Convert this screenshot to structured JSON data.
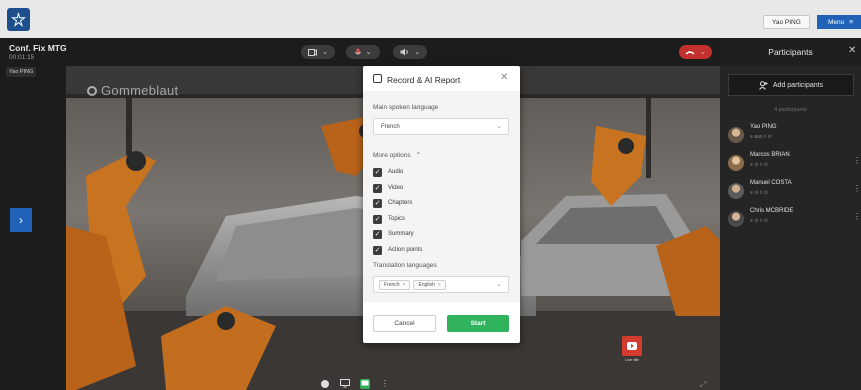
{
  "header": {
    "user_name": "Yao PING",
    "menu_label": "Menu",
    "colors": {
      "bar": "#e8e8e8",
      "accent": "#1f62b8",
      "logo_bg": "#1c4f8c"
    }
  },
  "conference": {
    "title": "Conf. Fix MTG",
    "elapsed": "00:01:15",
    "self_label": "Yao PING",
    "controls": {
      "camera_icon": "camera-icon",
      "mic_icon": "microphone-icon",
      "speaker_icon": "speaker-icon",
      "hangup_icon": "hang-up-icon",
      "end_color": "#c2312b"
    },
    "video": {
      "watermark": "Gommeblaut",
      "badge_label": "Live tile",
      "badge_color": "#d23b2e"
    },
    "bottom_tools": [
      "record-icon",
      "screen-share-icon",
      "chat-icon",
      "more-icon"
    ]
  },
  "participants_panel": {
    "title": "Participants",
    "add_label": "Add participants",
    "count_label": "4 participants",
    "participants": [
      {
        "name": "Yao PING",
        "status": "≡ aux ◊ ⊙"
      },
      {
        "name": "Marcos BRIAN",
        "status": "≡ ⊙ ◊ ⊙"
      },
      {
        "name": "Manuel COSTA",
        "status": "≡ ⊙ ◊ ⊙"
      },
      {
        "name": "Chris MCBRIDE",
        "status": "≡ ⊙ ◊ ⊙"
      }
    ]
  },
  "record_modal": {
    "title": "Record & AI Report",
    "language_label": "Main spoken language",
    "language_value": "French",
    "more_options_label": "More options",
    "options": [
      "Audio",
      "Video",
      "Chapters",
      "Topics",
      "Summary",
      "Action points"
    ],
    "options_checked": [
      true,
      true,
      true,
      true,
      true,
      true
    ],
    "translation_label": "Translation languages",
    "translation_tags": [
      "French",
      "English"
    ],
    "cancel_label": "Cancel",
    "start_label": "Start",
    "start_color": "#31b35e"
  }
}
